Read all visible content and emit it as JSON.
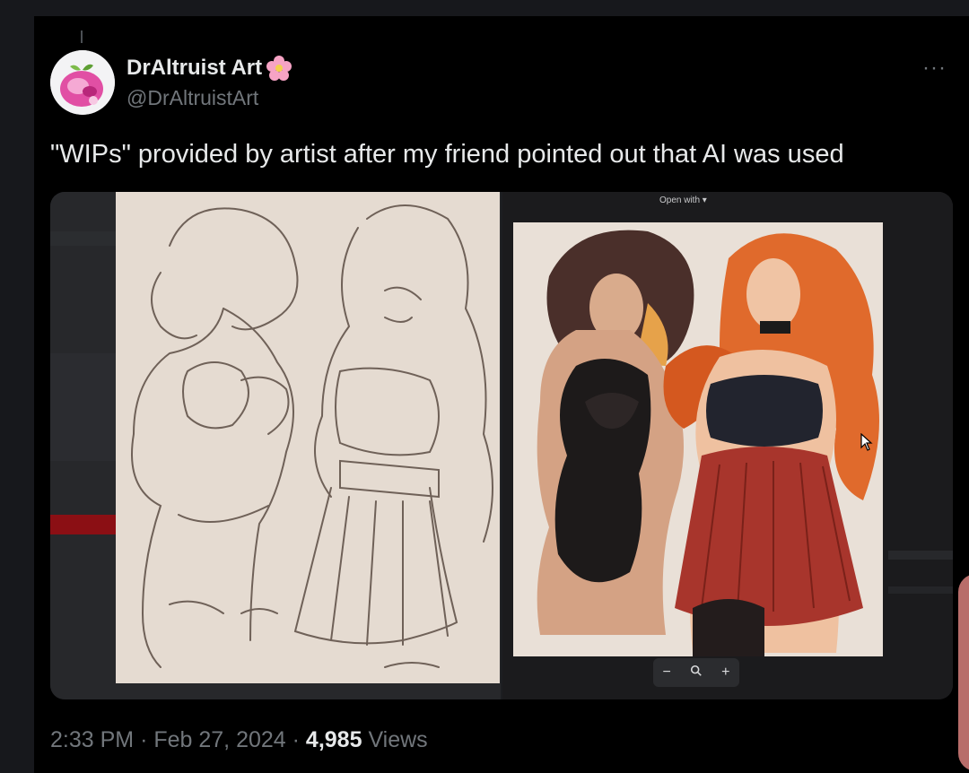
{
  "tweet": {
    "display_name": "DrAltruist Art",
    "name_emoji": "flower-emoji",
    "handle": "@DrAltruistArt",
    "more_icon": "···",
    "text": "\"WIPs\" provided by artist after my friend pointed out that AI was used",
    "media": {
      "left_image_alt": "sketch-wip",
      "right_image_alt": "finished-painting",
      "viewer_label": "Open with ▾",
      "zoom_out": "−",
      "zoom_icon": "magnifier-icon",
      "zoom_in": "+"
    },
    "time": "2:33 PM",
    "date": "Feb 27, 2024",
    "separator": "·",
    "views_count": "4,985",
    "views_label": "Views"
  },
  "colors": {
    "background": "#000000",
    "text_primary": "#e7e9ea",
    "text_secondary": "#71767b",
    "avatar_pink": "#e14fa4"
  }
}
